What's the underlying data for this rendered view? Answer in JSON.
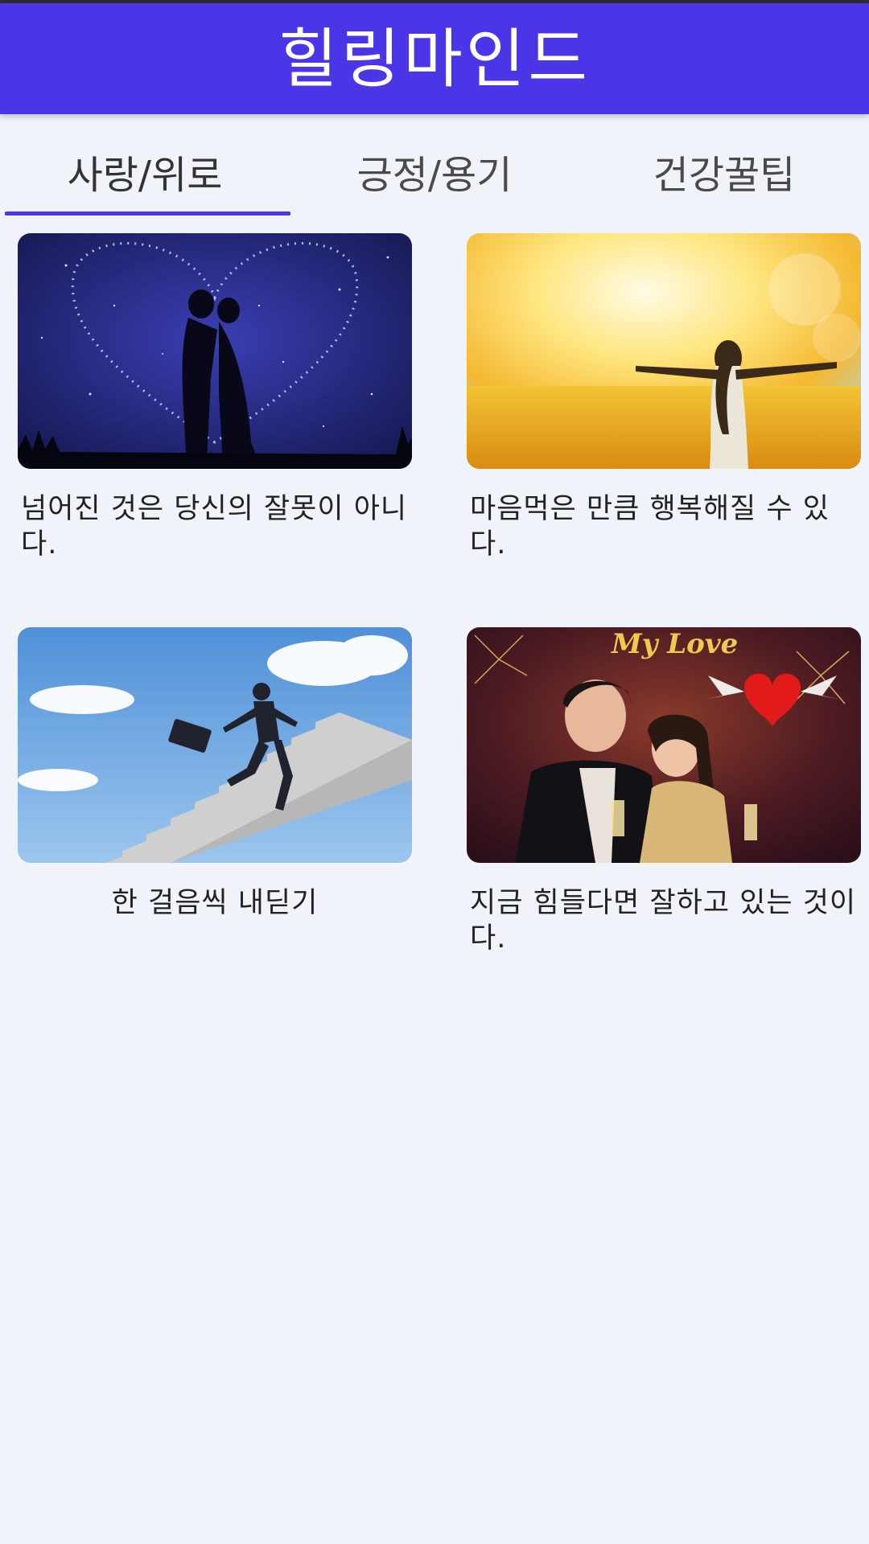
{
  "app": {
    "title": "힐링마인드",
    "accent_color": "#4a36e6",
    "background_color": "#f0f3f9"
  },
  "tabs": [
    {
      "label": "사랑/위로",
      "active": true
    },
    {
      "label": "긍정/용기",
      "active": false
    },
    {
      "label": "건강꿀팁",
      "active": false
    }
  ],
  "cards": [
    {
      "caption": "넘어진 것은 당신의 잘못이 아니다.",
      "image": "couple-silhouette-heart-night-image"
    },
    {
      "caption": "마음먹은 만큼 행복해질 수 있다.",
      "image": "woman-golden-field-sunlight-image"
    },
    {
      "caption": "한 걸음씩 내딛기",
      "image": "businessman-climbing-stairs-sky-image"
    },
    {
      "caption": "지금 힘들다면 잘하고 있는 것이다.",
      "image": "couple-fireworks-my-love-image"
    }
  ],
  "card_image_text": {
    "my_love": "My Love"
  }
}
